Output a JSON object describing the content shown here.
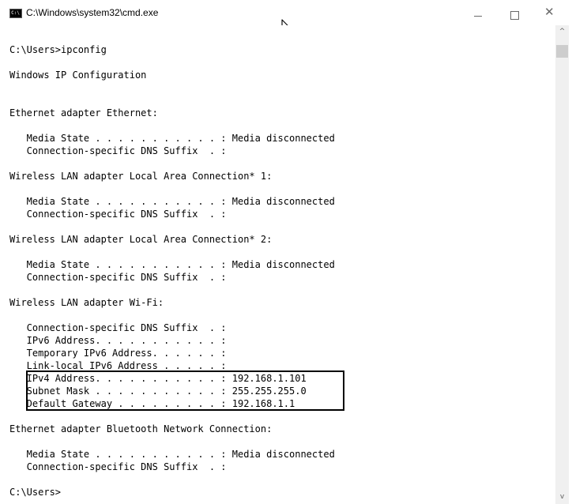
{
  "window": {
    "title": "C:\\Windows\\system32\\cmd.exe",
    "icon": "cmd-icon",
    "icon_glyph": "C:\\",
    "controls": {
      "minimize_icon": "minimize-icon",
      "maximize_icon": "maximize-icon",
      "close_icon": "close-icon",
      "close_glyph": "✕"
    }
  },
  "colors": {
    "console_background": "#ffffff",
    "console_text": "#000000",
    "highlight_border": "#000000",
    "scrollbar_track": "#f0f0f0",
    "scrollbar_thumb": "#cdcdcd"
  },
  "console": {
    "lines": [
      "C:\\Users>ipconfig",
      "Windows IP Configuration",
      "Ethernet adapter Ethernet:",
      "   Media State . . . . . . . . . . . : Media disconnected",
      "   Connection-specific DNS Suffix  . :",
      "Wireless LAN adapter Local Area Connection* 1:",
      "   Media State . . . . . . . . . . . : Media disconnected",
      "   Connection-specific DNS Suffix  . :",
      "Wireless LAN adapter Local Area Connection* 2:",
      "   Media State . . . . . . . . . . . : Media disconnected",
      "   Connection-specific DNS Suffix  . :",
      "Wireless LAN adapter Wi-Fi:",
      "   Connection-specific DNS Suffix  . :",
      "   IPv6 Address. . . . . . . . . . . :",
      "   Temporary IPv6 Address. . . . . . :",
      "   Link-local IPv6 Address . . . . . :",
      "   IPv4 Address. . . . . . . . . . . : 192.168.1.101",
      "   Subnet Mask . . . . . . . . . . . : 255.255.255.0",
      "   Default Gateway . . . . . . . . . : 192.168.1.1",
      "Ethernet adapter Bluetooth Network Connection:",
      "   Media State . . . . . . . . . . . : Media disconnected",
      "   Connection-specific DNS Suffix  . :",
      "C:\\Users>"
    ]
  },
  "scrollbar": {
    "up_arrow": "^",
    "down_arrow": "v"
  }
}
